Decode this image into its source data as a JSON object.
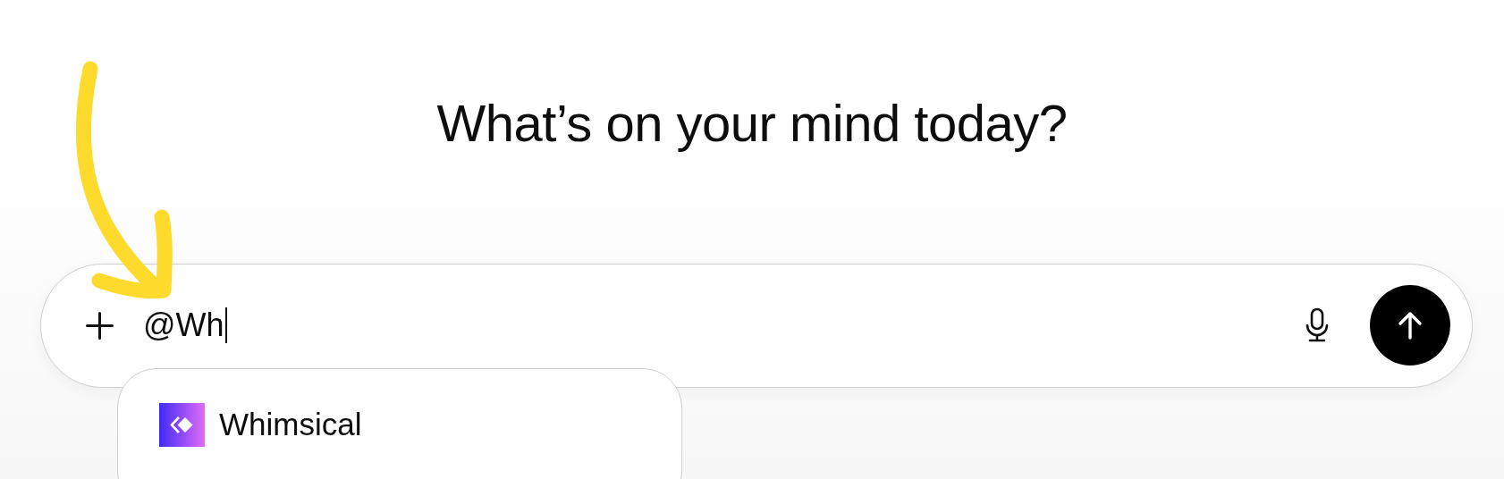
{
  "heading": "What’s on your mind today?",
  "composer": {
    "value": "@Wh"
  },
  "mention_menu": {
    "items": [
      {
        "label": "Whimsical"
      }
    ]
  }
}
